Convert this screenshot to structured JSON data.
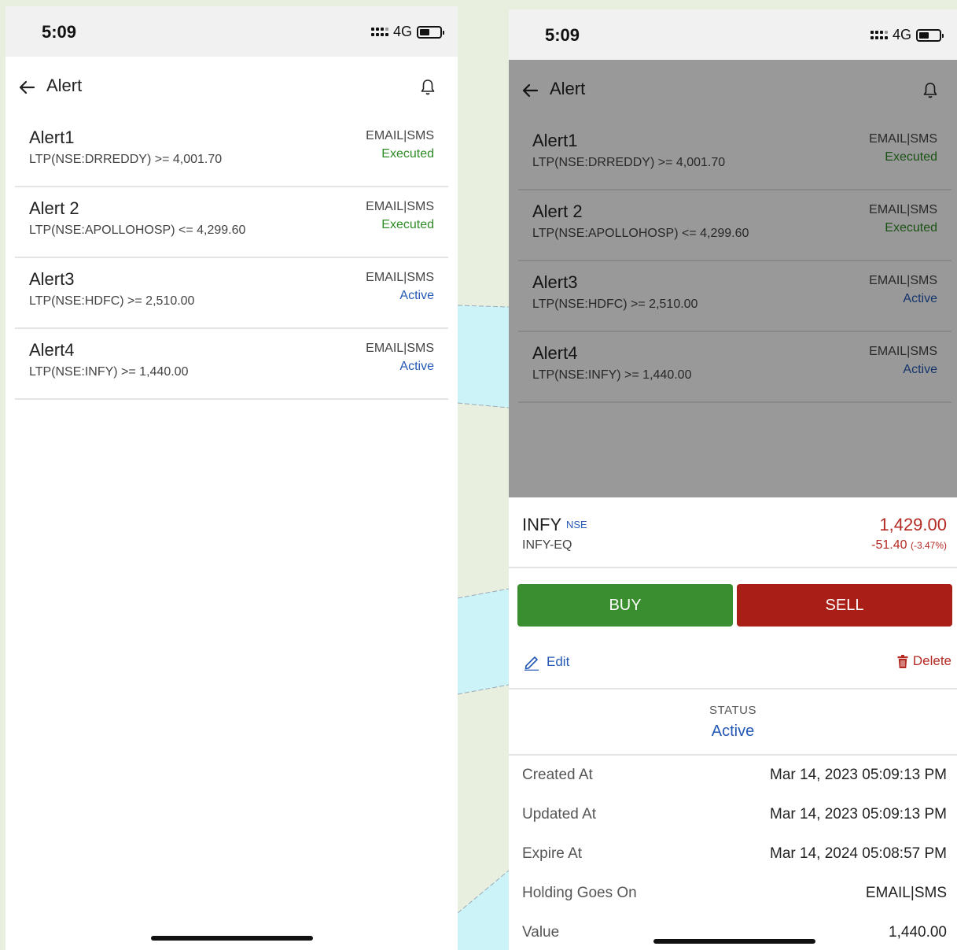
{
  "left_screen": {
    "status_bar": {
      "time": "5:09",
      "network": "4G"
    },
    "header": {
      "title": "Alert"
    },
    "alerts": [
      {
        "name": "Alert1",
        "condition": "LTP(NSE:DRREDDY) >= 4,001.70",
        "channels": "EMAIL|SMS",
        "status": "Executed"
      },
      {
        "name": "Alert 2",
        "condition": "LTP(NSE:APOLLOHOSP) <= 4,299.60",
        "channels": "EMAIL|SMS",
        "status": "Executed"
      },
      {
        "name": "Alert3",
        "condition": "LTP(NSE:HDFC) >= 2,510.00",
        "channels": "EMAIL|SMS",
        "status": "Active"
      },
      {
        "name": "Alert4",
        "condition": "LTP(NSE:INFY) >= 1,440.00",
        "channels": "EMAIL|SMS",
        "status": "Active"
      }
    ]
  },
  "right_screen": {
    "status_bar": {
      "time": "5:09",
      "network": "4G"
    },
    "header": {
      "title": "Alert"
    },
    "alerts": [
      {
        "name": "Alert1",
        "condition": "LTP(NSE:DRREDDY) >= 4,001.70",
        "channels": "EMAIL|SMS",
        "status": "Executed"
      },
      {
        "name": "Alert 2",
        "condition": "LTP(NSE:APOLLOHOSP) <= 4,299.60",
        "channels": "EMAIL|SMS",
        "status": "Executed"
      },
      {
        "name": "Alert3",
        "condition": "LTP(NSE:HDFC) >= 2,510.00",
        "channels": "EMAIL|SMS",
        "status": "Active"
      },
      {
        "name": "Alert4",
        "condition": "LTP(NSE:INFY) >= 1,440.00",
        "channels": "EMAIL|SMS",
        "status": "Active"
      }
    ],
    "sheet": {
      "symbol": "INFY",
      "exchange": "NSE",
      "series": "INFY-EQ",
      "price": "1,429.00",
      "change": "-51.40",
      "change_pct": "(-3.47%)",
      "buy_label": "BUY",
      "sell_label": "SELL",
      "edit_label": "Edit",
      "delete_label": "Delete",
      "status_label": "STATUS",
      "status_value": "Active",
      "details": [
        {
          "label": "Created At",
          "value": "Mar 14, 2023 05:09:13 PM"
        },
        {
          "label": "Updated At",
          "value": "Mar 14, 2023 05:09:13 PM"
        },
        {
          "label": "Expire At",
          "value": "Mar 14, 2024 05:08:57 PM"
        },
        {
          "label": "Holding Goes On",
          "value": "EMAIL|SMS"
        },
        {
          "label": "Value",
          "value": "1,440.00"
        }
      ]
    }
  },
  "colors": {
    "executed": "#2e8b25",
    "active": "#2459b5",
    "buy": "#3a8e2f",
    "sell": "#a91f17",
    "negative": "#b42a23"
  }
}
